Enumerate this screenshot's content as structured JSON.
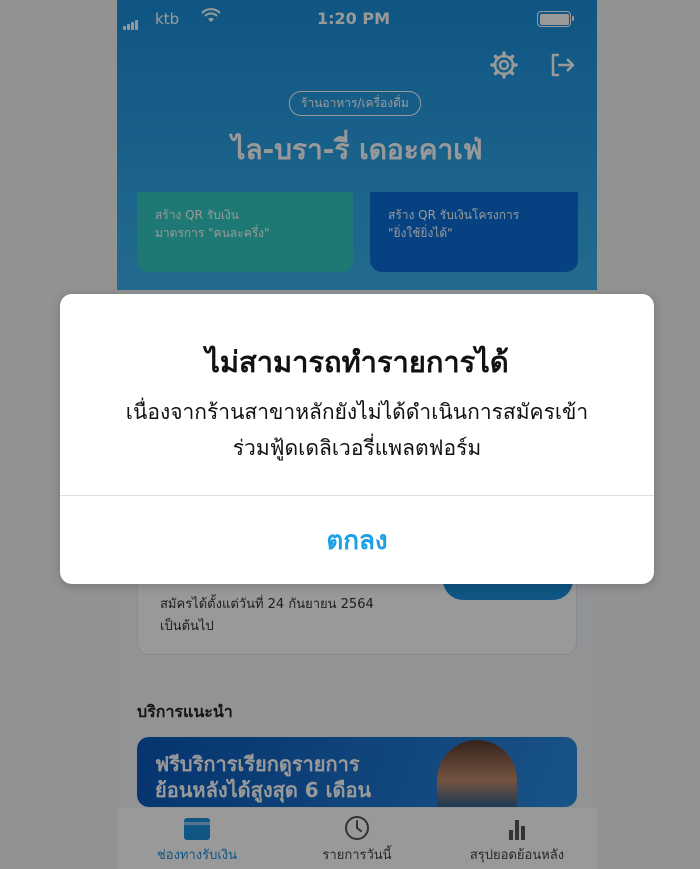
{
  "status_bar": {
    "carrier": "ktb",
    "time": "1:20 PM"
  },
  "header": {
    "category": "ร้านอาหาร/เครื่องดื่ม",
    "store_name": "ไล-บรา-รี่ เดอะคาเฟ่"
  },
  "cards": [
    {
      "desc_line1": "สร้าง QR รับเงิน",
      "desc_line2": "มาตรการ \"คนละครึ่ง\""
    },
    {
      "desc_line1": "สร้าง QR รับเงินโครงการ",
      "desc_line2": "\"ยิ่งใช้ยิ่งได้\""
    }
  ],
  "enroll_card": {
    "desc_line1": "สมัครได้ตั้งแต่วันที่ 24 กันยายน 2564",
    "desc_line2": "เป็นต้นไป"
  },
  "section": {
    "title": "บริการแนะนำ"
  },
  "promo": {
    "line1": "ฟรีบริการเรียกดูรายการ",
    "line2": "ย้อนหลังได้สูงสุด 6 เดือน"
  },
  "tabs": [
    {
      "label": "ช่องทางรับเงิน",
      "icon": "wallet-icon"
    },
    {
      "label": "รายการวันนี้",
      "icon": "clock-icon"
    },
    {
      "label": "สรุปยอดย้อนหลัง",
      "icon": "bar-chart-icon"
    }
  ],
  "dialog": {
    "title": "ไม่สามารถทำรายการได้",
    "message_line1": "เนื่องจากร้านสาขาหลักยังไม่ได้ดำเนินการสมัครเข้า",
    "message_line2": "ร่วมฟู้ดเดลิเวอรี่แพลตฟอร์ม",
    "ok_label": "ตกลง"
  },
  "colors": {
    "primary": "#1a8fdc",
    "accent_teal": "#33c9c0",
    "link": "#1ea0e6"
  }
}
